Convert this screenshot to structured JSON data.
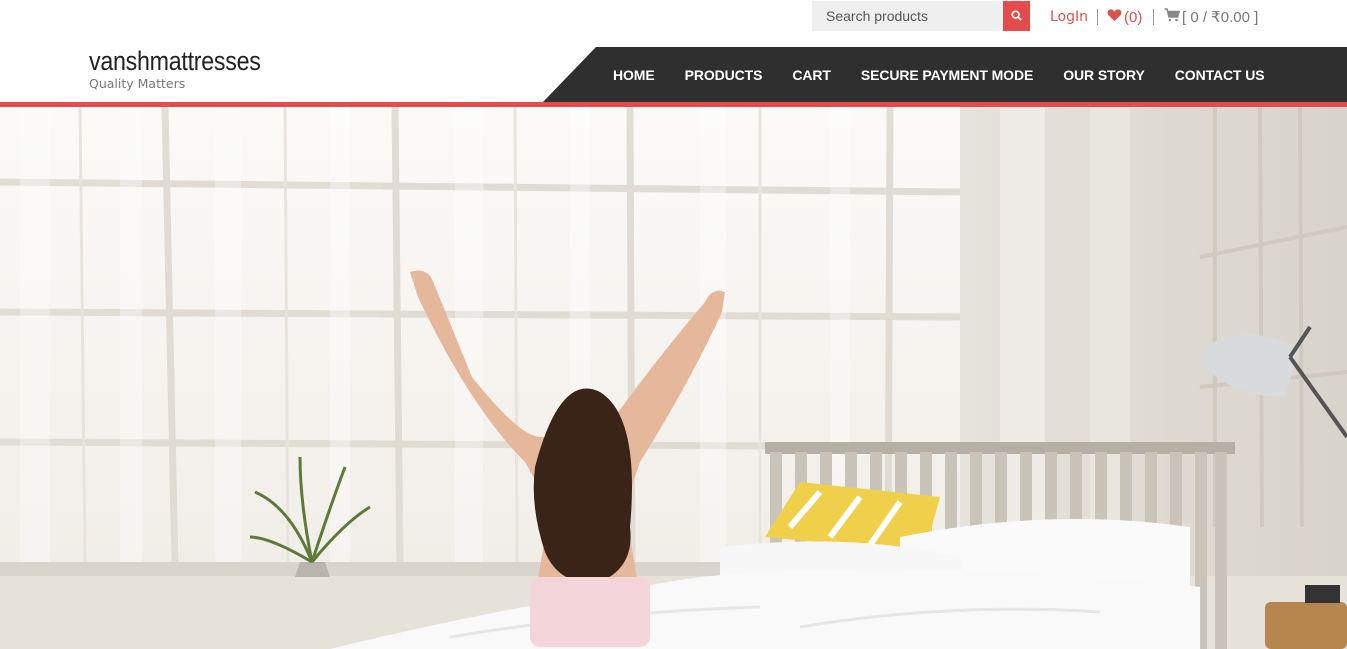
{
  "search": {
    "placeholder": "Search products"
  },
  "topbar": {
    "login_label": "LogIn",
    "wishlist_count": "(0)",
    "cart_summary": "[ 0 / ₹0.00 ]"
  },
  "logo": {
    "title": "vanshmattresses",
    "tagline": "Quality Matters"
  },
  "nav": {
    "items": [
      {
        "label": "HOME"
      },
      {
        "label": "PRODUCTS"
      },
      {
        "label": "CART"
      },
      {
        "label": "SECURE PAYMENT MODE"
      },
      {
        "label": "OUR STORY"
      },
      {
        "label": "CONTACT US"
      }
    ]
  },
  "colors": {
    "accent": "#e44c4c",
    "nav_bg": "#2f2f2f",
    "link_red": "#d9534f"
  },
  "icons": {
    "search": "search-icon",
    "heart": "heart-icon",
    "cart": "cart-icon"
  }
}
